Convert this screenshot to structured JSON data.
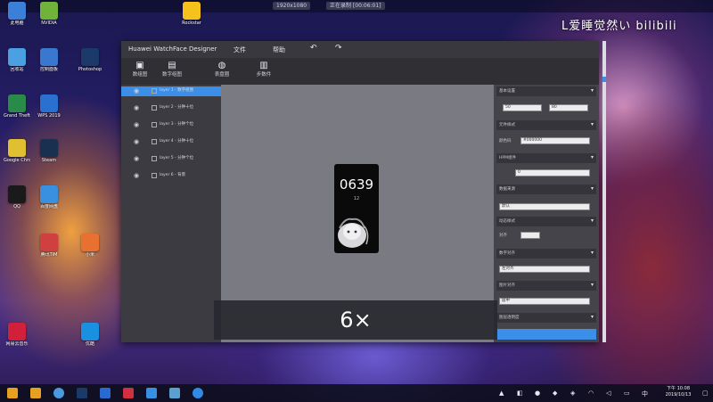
{
  "overlay": {
    "speed": "6×"
  },
  "bilibili": {
    "watermark": "L爱睡觉然い bilibili"
  },
  "app": {
    "title": "Huawei WatchFace Designer",
    "menu": [
      "文件",
      "帮助"
    ],
    "toolbar": [
      {
        "label": "数组图",
        "icon": "image-icon"
      },
      {
        "label": "数字组图",
        "icon": "digits-icon"
      },
      {
        "label": "表盘圈",
        "icon": "globe-icon"
      },
      {
        "label": "步数件",
        "icon": "chart-icon"
      }
    ],
    "layers": [
      "layer 1 - 数字组图",
      "layer 2 - 分钟十位",
      "layer 3 - 分钟个位",
      "layer 4 - 分钟十位",
      "layer 5 - 分钟个位",
      "layer 6 - 背景"
    ],
    "preview": {
      "time": "0639",
      "sub": "12"
    },
    "props": {
      "sections": [
        "基本设置",
        "元件样式",
        "HPM组件",
        "数据来源",
        "动态样式",
        "数字对齐",
        "图片对齐"
      ],
      "field_values": [
        "50",
        "80",
        "#000000",
        "0",
        "默认",
        "左对齐",
        "居中"
      ],
      "labels": [
        "颜色码",
        "对齐",
        "图层透明度"
      ]
    }
  },
  "topbar": {
    "resolution": "1920x1080",
    "record": "正在录制 [00:06:01]"
  },
  "desktop_icons": [
    {
      "label": "此电脑",
      "color": "#3b7fd8"
    },
    {
      "label": "Rockstar",
      "color": "#f4c21a"
    },
    {
      "label": "回收站",
      "color": "#4aa0e0"
    },
    {
      "label": "控制面板",
      "color": "#3a78d0"
    },
    {
      "label": "NVIDIA",
      "color": "#6fb33a"
    },
    {
      "label": "Photoshop",
      "color": "#1b3a6a"
    },
    {
      "label": "Grand Theft Auto V",
      "color": "#2a8a4a"
    },
    {
      "label": "WPS 2019",
      "color": "#2a70d0"
    },
    {
      "label": "Steam",
      "color": "#1a3050"
    },
    {
      "label": "Google Chrome",
      "color": "#e0c030"
    },
    {
      "label": "QQ",
      "color": "#1a1a1a"
    },
    {
      "label": "百度网盘",
      "color": "#3a90e0"
    },
    {
      "label": "腾讯TIM",
      "color": "#d04040"
    },
    {
      "label": "小米",
      "color": "#e87030"
    },
    {
      "label": "网易云音乐",
      "color": "#d0203a"
    },
    {
      "label": "优酷",
      "color": "#1a90e0"
    }
  ],
  "taskbar": {
    "clock_time": "下午 10:08",
    "clock_date": "2019/10/13"
  }
}
